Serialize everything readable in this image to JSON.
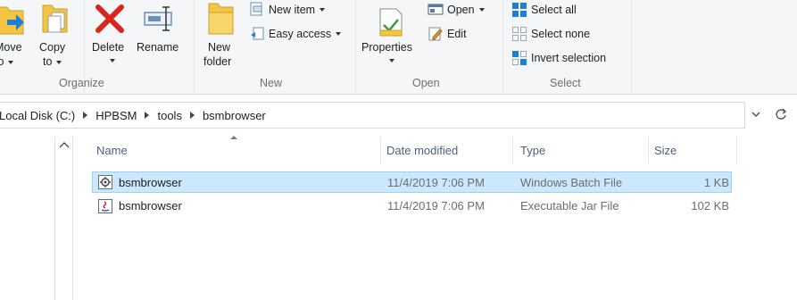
{
  "ribbon": {
    "organize": {
      "group_label": "Organize",
      "move_to": [
        "Move",
        "to"
      ],
      "copy_to": [
        "Copy",
        "to"
      ],
      "delete": "Delete",
      "rename": "Rename"
    },
    "new": {
      "group_label": "New",
      "new_folder": [
        "New",
        "folder"
      ],
      "new_item": "New item",
      "easy_access": "Easy access"
    },
    "open": {
      "group_label": "Open",
      "properties": "Properties",
      "open": "Open",
      "edit": "Edit"
    },
    "select": {
      "group_label": "Select",
      "select_all": "Select all",
      "select_none": "Select none",
      "invert_selection": "Invert selection"
    }
  },
  "address": {
    "crumbs": [
      "Local Disk (C:)",
      "HPBSM",
      "tools",
      "bsmbrowser"
    ]
  },
  "file_list": {
    "columns": {
      "name": "Name",
      "date_modified": "Date modified",
      "type": "Type",
      "size": "Size"
    },
    "rows": [
      {
        "name": "bsmbrowser",
        "date": "11/4/2019 7:06 PM",
        "type": "Windows Batch File",
        "size": "1 KB",
        "icon": "batch-file-icon",
        "selected": true
      },
      {
        "name": "bsmbrowser",
        "date": "11/4/2019 7:06 PM",
        "type": "Executable Jar File",
        "size": "102 KB",
        "icon": "jar-file-icon",
        "selected": false
      }
    ]
  },
  "colors": {
    "selection_bg": "#cce8ff",
    "selection_border": "#99d1ff",
    "header_text": "#4c607a",
    "folder_yellow": "#f4c542",
    "delete_red": "#d9261c",
    "select_blue": "#1e7fd6"
  }
}
